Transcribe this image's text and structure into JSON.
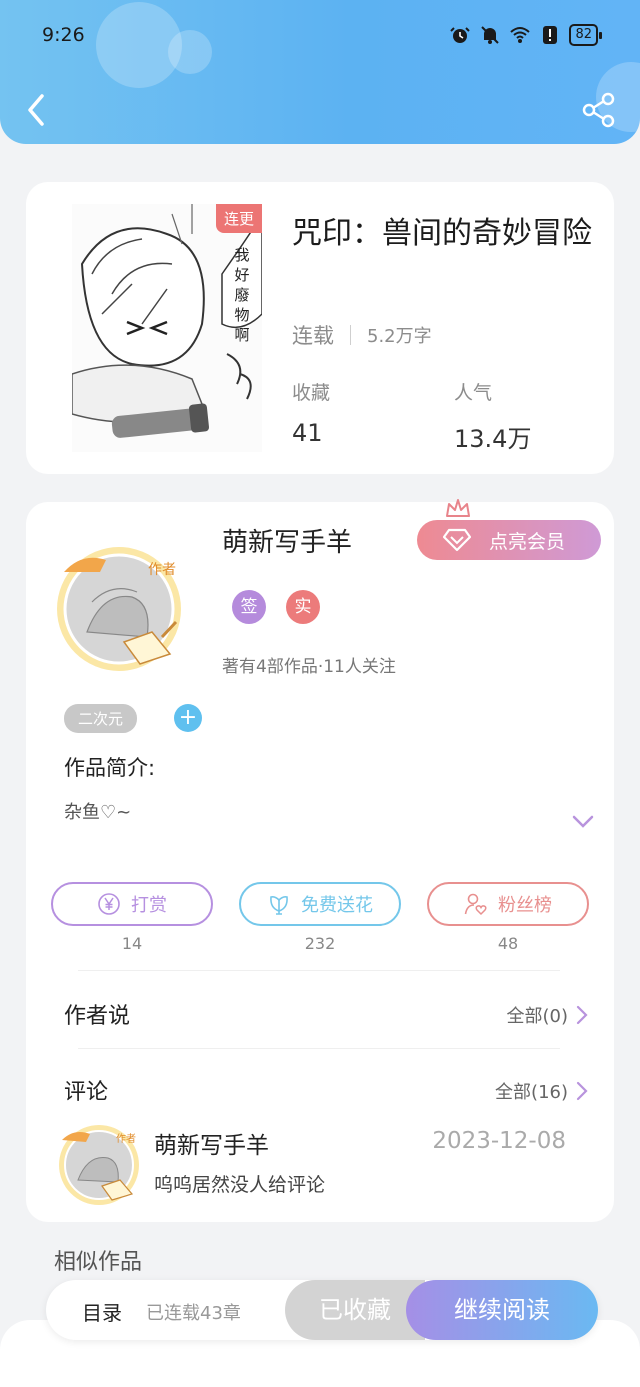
{
  "status_bar": {
    "time": "9:26",
    "battery": "82"
  },
  "book": {
    "tag": "连更",
    "title": "咒印：兽间的奇妙冒险",
    "status": "连载",
    "words": "5.2万字",
    "stats": [
      {
        "label": "收藏",
        "value": "41"
      },
      {
        "label": "人气",
        "value": "13.4万"
      }
    ],
    "cover_text": "我好廢物啊"
  },
  "author": {
    "name": "萌新写手羊",
    "vip_label": "点亮会员",
    "avatar_tag": "作者",
    "badges": [
      {
        "text": "签",
        "color": "#b58bdc"
      },
      {
        "text": "实",
        "color": "#ec7b7b"
      }
    ],
    "works_info": "著有4部作品·11人关注",
    "genre_tag": "二次元",
    "add_tag": "+"
  },
  "intro": {
    "label": "作品简介:",
    "text": "杂鱼♡~"
  },
  "actions": [
    {
      "label": "打赏",
      "count": "14",
      "color": "#b690e0",
      "icon": "yen-coin-icon"
    },
    {
      "label": "免费送花",
      "count": "232",
      "color": "#74c7ea",
      "icon": "flower-icon"
    },
    {
      "label": "粉丝榜",
      "count": "48",
      "color": "#e8908f",
      "icon": "fan-person-icon"
    }
  ],
  "author_says": {
    "title": "作者说",
    "more": "全部(0)"
  },
  "comments": {
    "title": "评论",
    "more": "全部(16)",
    "items": [
      {
        "name": "萌新写手羊",
        "date": "2023-12-08",
        "text": "呜呜居然没人给评论"
      }
    ]
  },
  "similar": {
    "title": "相似作品"
  },
  "bottom_bar": {
    "toc_label": "目录",
    "toc_count": "已连载43章",
    "collected_label": "已收藏",
    "read_label": "继续阅读"
  },
  "colors": {
    "header_gradient_start": "#74c3f1",
    "header_gradient_end": "#62b4f6",
    "accent_purple": "#b690e0",
    "accent_blue": "#74c7ea",
    "accent_red": "#e8908f"
  }
}
